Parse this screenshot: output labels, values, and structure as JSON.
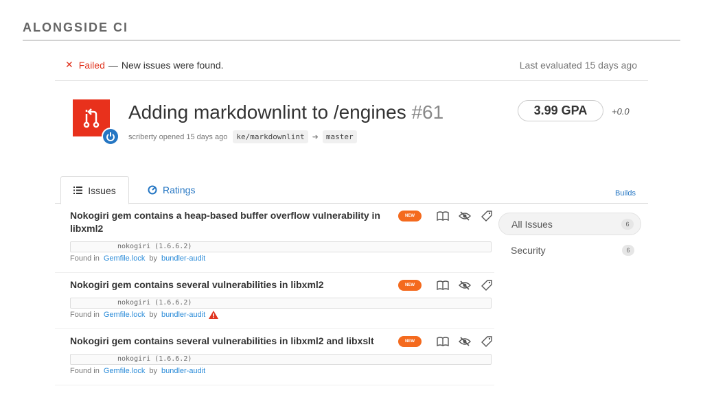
{
  "slide": {
    "title": "ALONGSIDE CI"
  },
  "status": {
    "icon": "x-icon",
    "failed_label": "Failed",
    "dash": "—",
    "message": "New issues were found.",
    "last_evaluated": "Last evaluated 15 days ago",
    "colors": {
      "failed": "#e0341f"
    }
  },
  "pr": {
    "icon": "pull-request-icon",
    "badge_icon": "power-icon",
    "title": "Adding markdownlint to /engines",
    "number": "#61",
    "opener": "scriberty opened 15 days ago",
    "source_branch": "ke/markdownlint",
    "arrow": "➜",
    "target_branch": "master",
    "colors": {
      "icon_bg": "#e8311c",
      "badge": "#2576c3"
    }
  },
  "gpa": {
    "value": "3.99 GPA",
    "delta": "+0.0"
  },
  "tabs": {
    "issues_label": "Issues",
    "ratings_label": "Ratings",
    "builds_label": "Builds"
  },
  "issues": [
    {
      "title": "Nokogiri gem contains a heap-based buffer overflow vulnerability in libxml2",
      "badge": "NEW",
      "code": "nokogiri (1.6.6.2)",
      "found_in": "Found in",
      "file": "Gemfile.lock",
      "by": "by",
      "engine": "bundler-audit",
      "warning": false
    },
    {
      "title": "Nokogiri gem contains several vulnerabilities in libxml2",
      "badge": "NEW",
      "code": "nokogiri (1.6.6.2)",
      "found_in": "Found in",
      "file": "Gemfile.lock",
      "by": "by",
      "engine": "bundler-audit",
      "warning": true
    },
    {
      "title": "Nokogiri gem contains several vulnerabilities in libxml2 and libxslt",
      "badge": "NEW",
      "code": "nokogiri (1.6.6.2)",
      "found_in": "Found in",
      "file": "Gemfile.lock",
      "by": "by",
      "engine": "bundler-audit",
      "warning": false
    }
  ],
  "sidebar": {
    "items": [
      {
        "label": "All Issues",
        "count": "6"
      },
      {
        "label": "Security",
        "count": "6"
      }
    ]
  },
  "colors": {
    "link": "#2576c3",
    "new_badge": "#f46a1e",
    "warning": "#e0341f"
  }
}
